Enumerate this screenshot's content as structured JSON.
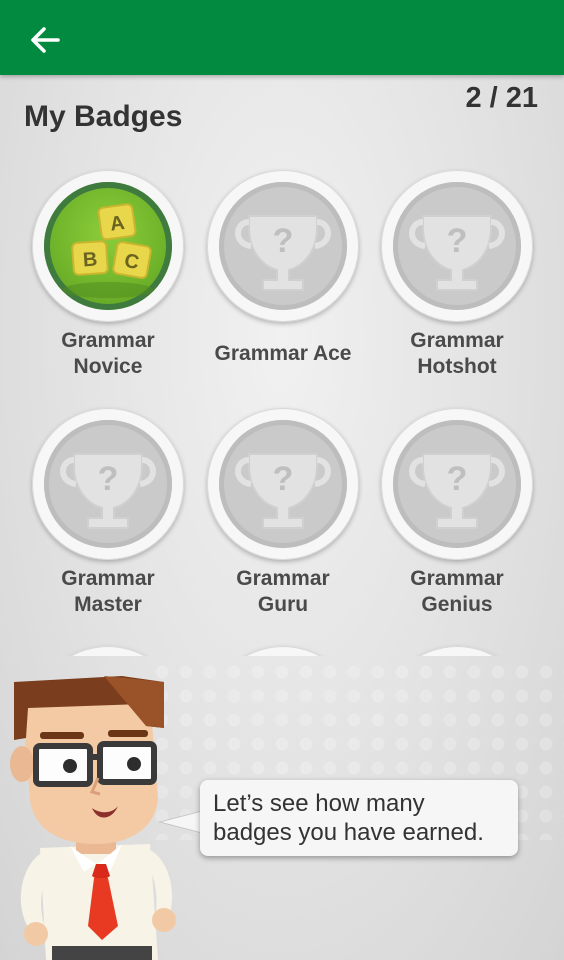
{
  "header": {
    "back_icon": "arrow-left-icon",
    "bar_color": "#028a41"
  },
  "page": {
    "title": "My Badges",
    "counter": "2 / 21"
  },
  "badges": [
    {
      "name": "Grammar\nNovice",
      "earned": true,
      "icon": "abc-blocks-icon"
    },
    {
      "name": "Grammar Ace",
      "earned": false,
      "icon": "trophy-question-icon"
    },
    {
      "name": "Grammar\nHotshot",
      "earned": false,
      "icon": "trophy-question-icon"
    },
    {
      "name": "Grammar\nMaster",
      "earned": false,
      "icon": "trophy-question-icon"
    },
    {
      "name": "Grammar\nGuru",
      "earned": false,
      "icon": "trophy-question-icon"
    },
    {
      "name": "Grammar\nGenius",
      "earned": false,
      "icon": "trophy-question-icon"
    }
  ],
  "blocks": {
    "a": "A",
    "b": "B",
    "c": "C"
  },
  "mascot": {
    "speech": "Let’s see how many badges you have earned."
  }
}
